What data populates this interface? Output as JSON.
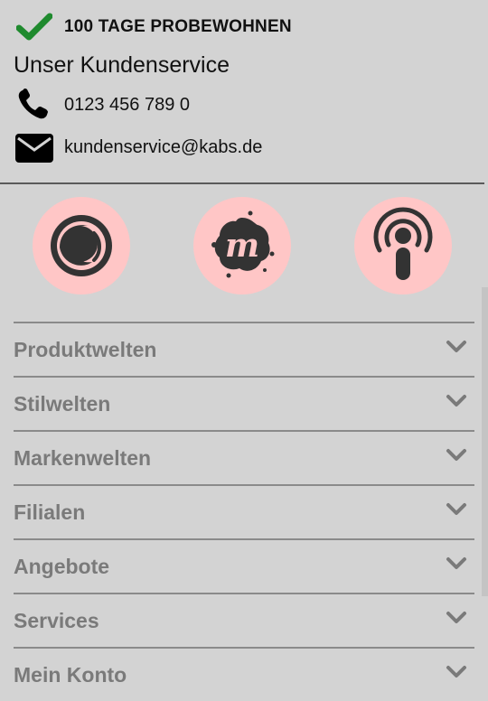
{
  "feature": {
    "text": "100 TAGE PROBEWOHNEN",
    "icon": "check-icon",
    "icon_color": "#1f8a2e"
  },
  "service": {
    "title": "Unser Kundenservice",
    "phone": {
      "icon": "phone-icon",
      "value": "0123 456 789 0"
    },
    "email": {
      "icon": "envelope-icon",
      "value": "kundenservice@kabs.de"
    }
  },
  "socials": [
    {
      "icon": "flickr-style-icon"
    },
    {
      "icon": "meetup-icon"
    },
    {
      "icon": "podcast-icon"
    }
  ],
  "colors": {
    "background": "#d3d3d3",
    "social_bg": "#ffc6c6",
    "menu_text": "#7a7a7a"
  },
  "menu": [
    {
      "label": "Produktwelten",
      "icon": "chevron-down-icon"
    },
    {
      "label": "Stilwelten",
      "icon": "chevron-down-icon"
    },
    {
      "label": "Markenwelten",
      "icon": "chevron-down-icon"
    },
    {
      "label": "Filialen",
      "icon": "chevron-down-icon"
    },
    {
      "label": "Angebote",
      "icon": "chevron-down-icon"
    },
    {
      "label": "Services",
      "icon": "chevron-down-icon"
    },
    {
      "label": "Mein Konto",
      "icon": "chevron-down-icon"
    }
  ]
}
